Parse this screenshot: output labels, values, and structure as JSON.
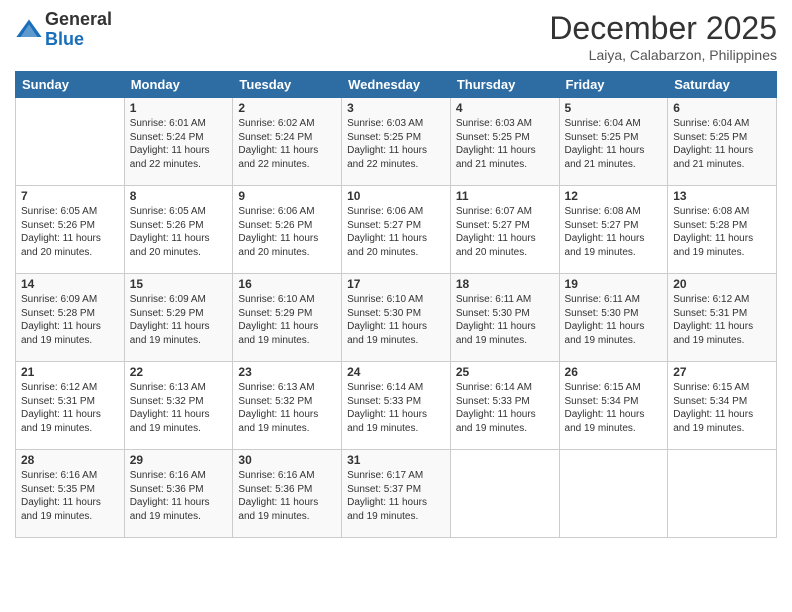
{
  "header": {
    "logo_line1": "General",
    "logo_line2": "Blue",
    "month": "December 2025",
    "location": "Laiya, Calabarzon, Philippines"
  },
  "days_of_week": [
    "Sunday",
    "Monday",
    "Tuesday",
    "Wednesday",
    "Thursday",
    "Friday",
    "Saturday"
  ],
  "weeks": [
    [
      {
        "day": "",
        "info": ""
      },
      {
        "day": "1",
        "info": "Sunrise: 6:01 AM\nSunset: 5:24 PM\nDaylight: 11 hours\nand 22 minutes."
      },
      {
        "day": "2",
        "info": "Sunrise: 6:02 AM\nSunset: 5:24 PM\nDaylight: 11 hours\nand 22 minutes."
      },
      {
        "day": "3",
        "info": "Sunrise: 6:03 AM\nSunset: 5:25 PM\nDaylight: 11 hours\nand 22 minutes."
      },
      {
        "day": "4",
        "info": "Sunrise: 6:03 AM\nSunset: 5:25 PM\nDaylight: 11 hours\nand 21 minutes."
      },
      {
        "day": "5",
        "info": "Sunrise: 6:04 AM\nSunset: 5:25 PM\nDaylight: 11 hours\nand 21 minutes."
      },
      {
        "day": "6",
        "info": "Sunrise: 6:04 AM\nSunset: 5:25 PM\nDaylight: 11 hours\nand 21 minutes."
      }
    ],
    [
      {
        "day": "7",
        "info": "Sunrise: 6:05 AM\nSunset: 5:26 PM\nDaylight: 11 hours\nand 20 minutes."
      },
      {
        "day": "8",
        "info": "Sunrise: 6:05 AM\nSunset: 5:26 PM\nDaylight: 11 hours\nand 20 minutes."
      },
      {
        "day": "9",
        "info": "Sunrise: 6:06 AM\nSunset: 5:26 PM\nDaylight: 11 hours\nand 20 minutes."
      },
      {
        "day": "10",
        "info": "Sunrise: 6:06 AM\nSunset: 5:27 PM\nDaylight: 11 hours\nand 20 minutes."
      },
      {
        "day": "11",
        "info": "Sunrise: 6:07 AM\nSunset: 5:27 PM\nDaylight: 11 hours\nand 20 minutes."
      },
      {
        "day": "12",
        "info": "Sunrise: 6:08 AM\nSunset: 5:27 PM\nDaylight: 11 hours\nand 19 minutes."
      },
      {
        "day": "13",
        "info": "Sunrise: 6:08 AM\nSunset: 5:28 PM\nDaylight: 11 hours\nand 19 minutes."
      }
    ],
    [
      {
        "day": "14",
        "info": "Sunrise: 6:09 AM\nSunset: 5:28 PM\nDaylight: 11 hours\nand 19 minutes."
      },
      {
        "day": "15",
        "info": "Sunrise: 6:09 AM\nSunset: 5:29 PM\nDaylight: 11 hours\nand 19 minutes."
      },
      {
        "day": "16",
        "info": "Sunrise: 6:10 AM\nSunset: 5:29 PM\nDaylight: 11 hours\nand 19 minutes."
      },
      {
        "day": "17",
        "info": "Sunrise: 6:10 AM\nSunset: 5:30 PM\nDaylight: 11 hours\nand 19 minutes."
      },
      {
        "day": "18",
        "info": "Sunrise: 6:11 AM\nSunset: 5:30 PM\nDaylight: 11 hours\nand 19 minutes."
      },
      {
        "day": "19",
        "info": "Sunrise: 6:11 AM\nSunset: 5:30 PM\nDaylight: 11 hours\nand 19 minutes."
      },
      {
        "day": "20",
        "info": "Sunrise: 6:12 AM\nSunset: 5:31 PM\nDaylight: 11 hours\nand 19 minutes."
      }
    ],
    [
      {
        "day": "21",
        "info": "Sunrise: 6:12 AM\nSunset: 5:31 PM\nDaylight: 11 hours\nand 19 minutes."
      },
      {
        "day": "22",
        "info": "Sunrise: 6:13 AM\nSunset: 5:32 PM\nDaylight: 11 hours\nand 19 minutes."
      },
      {
        "day": "23",
        "info": "Sunrise: 6:13 AM\nSunset: 5:32 PM\nDaylight: 11 hours\nand 19 minutes."
      },
      {
        "day": "24",
        "info": "Sunrise: 6:14 AM\nSunset: 5:33 PM\nDaylight: 11 hours\nand 19 minutes."
      },
      {
        "day": "25",
        "info": "Sunrise: 6:14 AM\nSunset: 5:33 PM\nDaylight: 11 hours\nand 19 minutes."
      },
      {
        "day": "26",
        "info": "Sunrise: 6:15 AM\nSunset: 5:34 PM\nDaylight: 11 hours\nand 19 minutes."
      },
      {
        "day": "27",
        "info": "Sunrise: 6:15 AM\nSunset: 5:34 PM\nDaylight: 11 hours\nand 19 minutes."
      }
    ],
    [
      {
        "day": "28",
        "info": "Sunrise: 6:16 AM\nSunset: 5:35 PM\nDaylight: 11 hours\nand 19 minutes."
      },
      {
        "day": "29",
        "info": "Sunrise: 6:16 AM\nSunset: 5:36 PM\nDaylight: 11 hours\nand 19 minutes."
      },
      {
        "day": "30",
        "info": "Sunrise: 6:16 AM\nSunset: 5:36 PM\nDaylight: 11 hours\nand 19 minutes."
      },
      {
        "day": "31",
        "info": "Sunrise: 6:17 AM\nSunset: 5:37 PM\nDaylight: 11 hours\nand 19 minutes."
      },
      {
        "day": "",
        "info": ""
      },
      {
        "day": "",
        "info": ""
      },
      {
        "day": "",
        "info": ""
      }
    ]
  ]
}
